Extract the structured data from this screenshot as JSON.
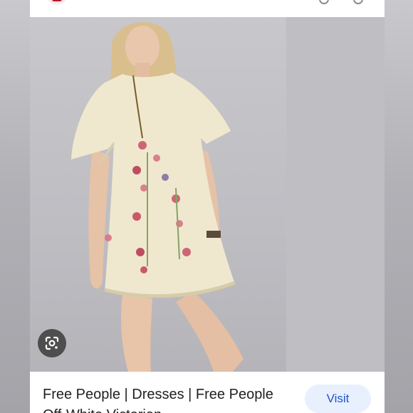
{
  "result": {
    "title": "Free People | Dresses | Free People Off-White Victorian",
    "visit_label": "Visit"
  },
  "icons": {
    "source_logo": "red-square-logo-icon",
    "lens": "google-lens-icon",
    "top_right": [
      "share-icon",
      "bookmark-icon"
    ]
  },
  "colors": {
    "visit_bg": "#e8f0fe",
    "visit_text": "#1a56c8",
    "logo": "#b31b2c"
  }
}
